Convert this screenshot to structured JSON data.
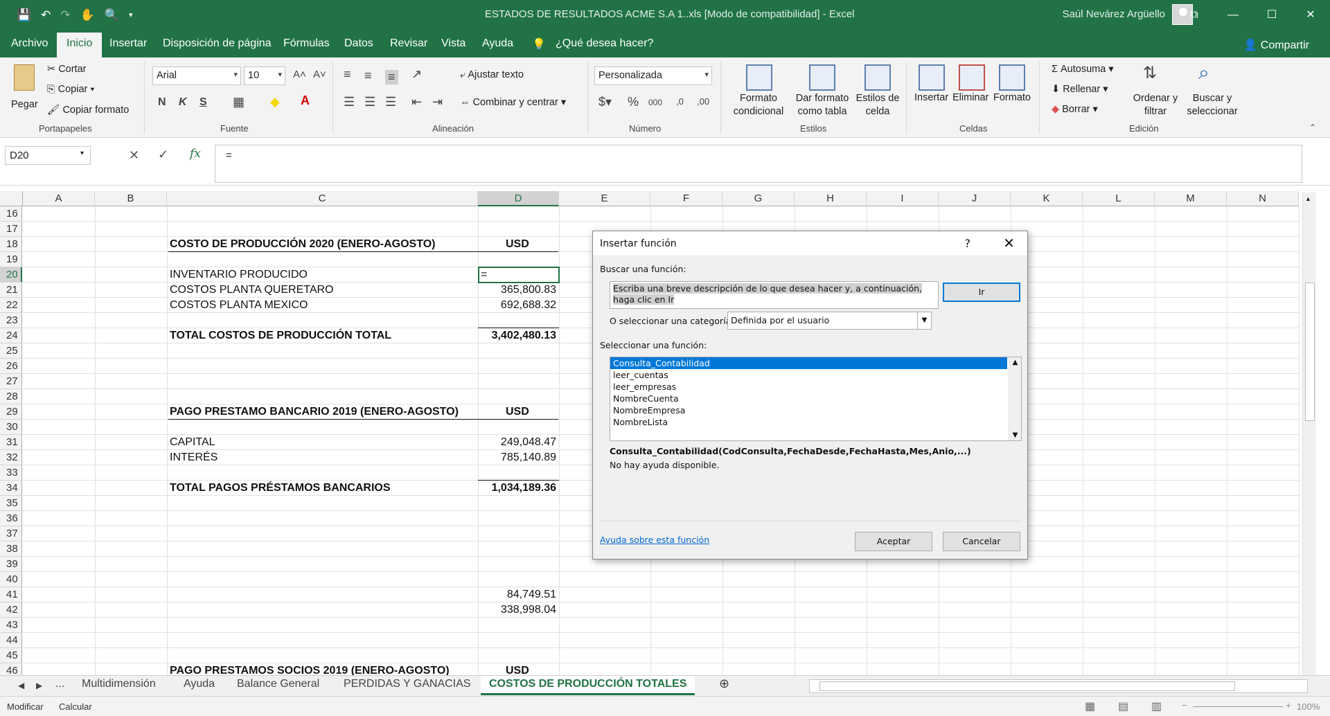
{
  "window": {
    "title": "ESTADOS DE RESULTADOS ACME S.A 1..xls  [Modo de compatibilidad]  -  Excel",
    "user": "Saúl Nevárez Argüello",
    "controls": [
      "⧉",
      "—",
      "☐",
      "✕"
    ]
  },
  "quick_access": [
    "💾",
    "↶",
    "↷",
    "✋",
    "🔍",
    "▾"
  ],
  "menu": {
    "tabs": [
      "Archivo",
      "Inicio",
      "Insertar",
      "Disposición de página",
      "Fórmulas",
      "Datos",
      "Revisar",
      "Vista",
      "Ayuda"
    ],
    "tell_me": "¿Qué desea hacer?",
    "share": "Compartir"
  },
  "ribbon": {
    "clipboard": {
      "paste": "Pegar",
      "cut": "Cortar",
      "copy": "Copiar",
      "format_painter": "Copiar formato",
      "group": "Portapapeles"
    },
    "font": {
      "name": "Arial",
      "size": "10",
      "bold": "N",
      "italic": "K",
      "underline": "S",
      "group": "Fuente"
    },
    "alignment": {
      "wrap": "Ajustar texto",
      "merge": "Combinar y centrar",
      "group": "Alineación"
    },
    "number": {
      "format": "Personalizada",
      "group": "Número"
    },
    "styles": {
      "conditional": "Formato condicional",
      "as_table": "Dar formato como tabla",
      "cell_styles": "Estilos de celda",
      "group": "Estilos"
    },
    "cells": {
      "insert": "Insertar",
      "delete": "Eliminar",
      "format": "Formato",
      "group": "Celdas"
    },
    "editing": {
      "autosum": "Autosuma",
      "fill": "Rellenar",
      "clear": "Borrar",
      "sort": "Ordenar y filtrar",
      "find": "Buscar y seleccionar",
      "group": "Edición"
    }
  },
  "formula_bar": {
    "name_box": "D20",
    "formula": "="
  },
  "columns": [
    "A",
    "B",
    "C",
    "D",
    "E",
    "F",
    "G",
    "H",
    "I",
    "J",
    "K",
    "L",
    "M",
    "N"
  ],
  "rows": [
    "16",
    "17",
    "18",
    "19",
    "20",
    "21",
    "22",
    "23",
    "24",
    "25",
    "26",
    "27",
    "28",
    "29",
    "30",
    "31",
    "32",
    "33",
    "34",
    "35",
    "36",
    "37",
    "38",
    "39",
    "40",
    "41",
    "42",
    "43",
    "44",
    "45",
    "46"
  ],
  "sheet": {
    "costo_title": "COSTO DE PRODUCCIÓN 2020 (ENERO-AGOSTO)",
    "usd": "USD",
    "inventario": "INVENTARIO PRODUCIDO",
    "inventario_val": "=",
    "queretaro": "COSTOS PLANTA QUERETARO",
    "queretaro_val": "365,800.83",
    "mexico": "COSTOS PLANTA MEXICO",
    "mexico_val": "692,688.32",
    "total_costos": "TOTAL COSTOS DE PRODUCCIÓN TOTAL",
    "total_costos_val": "3,402,480.13",
    "prestamo_title": "PAGO PRESTAMO BANCARIO 2019 (ENERO-AGOSTO)",
    "capital": "CAPITAL",
    "capital_val": "249,048.47",
    "interes": "INTERÉS",
    "interes_val": "785,140.89",
    "total_prestamos": "TOTAL PAGOS PRÉSTAMOS BANCARIOS",
    "total_prestamos_val": "1,034,189.36",
    "val41": "84,749.51",
    "val42": "338,998.04",
    "socios_title": "PAGO PRESTAMOS SOCIOS 2019 (ENERO-AGOSTO)"
  },
  "sheet_tabs": [
    "...",
    "Multidimensión",
    "Ayuda",
    "Balance General",
    "PERDIDAS Y GANACIAS",
    "COSTOS DE PRODUCCIÓN TOTALES"
  ],
  "status": {
    "mode": "Modificar",
    "calc": "Calcular",
    "zoom": "100%"
  },
  "dialog": {
    "title": "Insertar función",
    "help_btn": "?",
    "close": "✕",
    "search_label": "Buscar una función:",
    "search_value": "Escriba una breve descripción de lo que desea hacer y, a continuación, haga clic en Ir",
    "go": "Ir",
    "category_label": "O seleccionar una categoría:",
    "category_value": "Definida por el usuario",
    "select_label": "Seleccionar una función:",
    "functions": [
      "Consulta_Contabilidad",
      "leer_cuentas",
      "leer_empresas",
      "NombreCuenta",
      "NombreEmpresa",
      "NombreLista"
    ],
    "signature": "Consulta_Contabilidad(CodConsulta,FechaDesde,FechaHasta,Mes,Anio,...)",
    "help_text": "No hay ayuda disponible.",
    "help_link": "Ayuda sobre esta función",
    "ok": "Aceptar",
    "cancel": "Cancelar"
  }
}
